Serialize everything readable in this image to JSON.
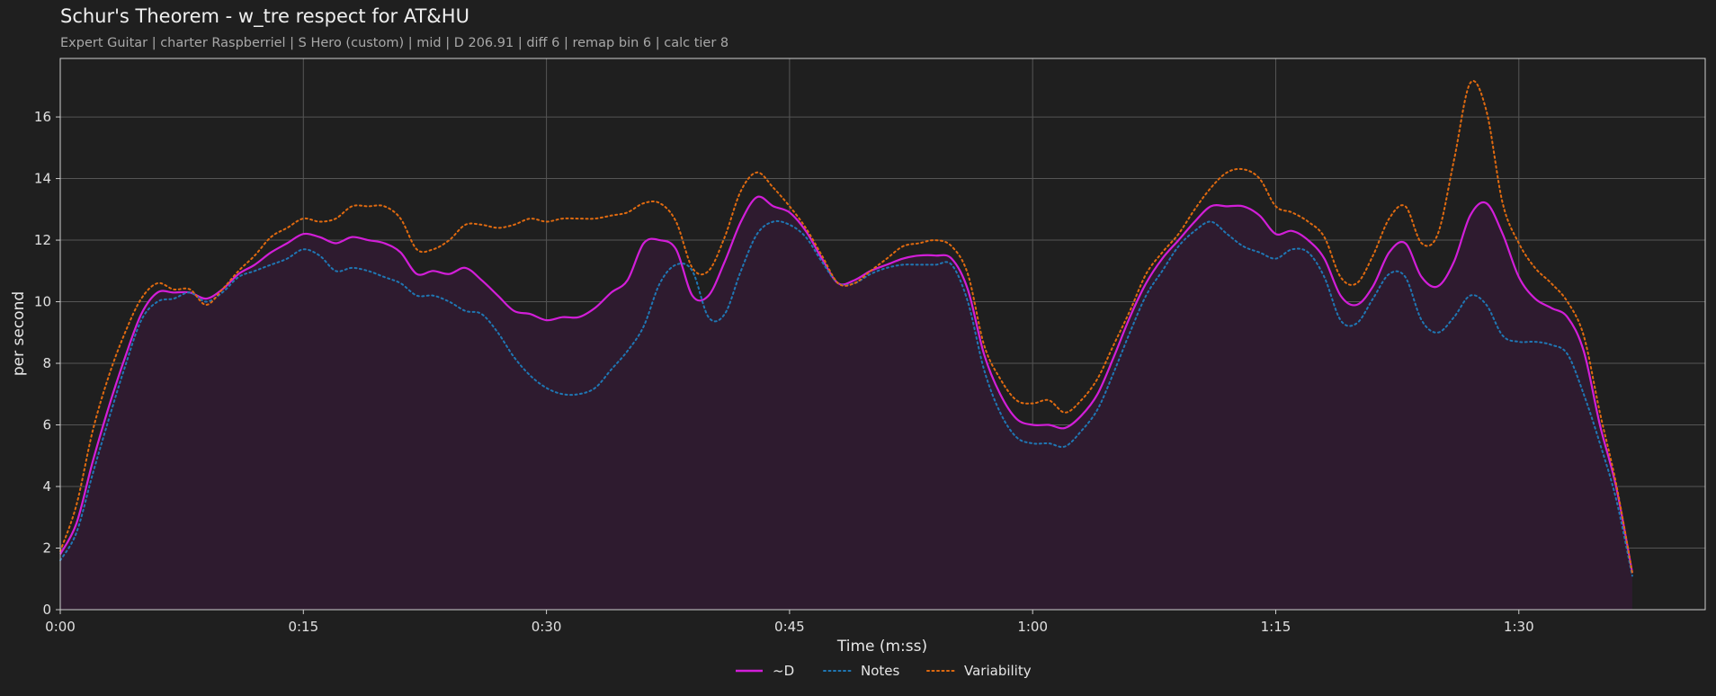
{
  "title": "Schur's Theorem - w_tre respect for AT&HU",
  "subtitle": "Expert Guitar  |  charter Raspberriel  |  S Hero (custom)  |  mid  |  D 206.91  |  diff 6  |  remap bin 6  |  calc tier 8",
  "colors": {
    "background": "#1f1f1f",
    "grid": "#555555",
    "d": "#d21ed8",
    "notes": "#1f77b4",
    "variability": "#e06a10",
    "fill": "#2e1b2f"
  },
  "chart_data": {
    "type": "line",
    "xlabel": "Time (m:ss)",
    "ylabel": "per second",
    "xlim": [
      0,
      101.5
    ],
    "ylim": [
      0,
      17.9
    ],
    "grid": true,
    "legend_position": "bottom-center",
    "x_ticks": [
      {
        "value": 0,
        "label": "0:00"
      },
      {
        "value": 15,
        "label": "0:15"
      },
      {
        "value": 30,
        "label": "0:30"
      },
      {
        "value": 45,
        "label": "0:45"
      },
      {
        "value": 60,
        "label": "1:00"
      },
      {
        "value": 75,
        "label": "1:15"
      },
      {
        "value": 90,
        "label": "1:30"
      }
    ],
    "y_ticks": [
      0,
      2,
      4,
      6,
      8,
      10,
      12,
      14,
      16
    ],
    "series": [
      {
        "name": "~D",
        "style": "solid",
        "filled": true,
        "points": [
          [
            0,
            1.8
          ],
          [
            1,
            2.8
          ],
          [
            2,
            4.8
          ],
          [
            3,
            6.6
          ],
          [
            4,
            8.2
          ],
          [
            5,
            9.6
          ],
          [
            6,
            10.3
          ],
          [
            7,
            10.3
          ],
          [
            8,
            10.3
          ],
          [
            9,
            10.1
          ],
          [
            10,
            10.4
          ],
          [
            11,
            10.9
          ],
          [
            12,
            11.2
          ],
          [
            13,
            11.6
          ],
          [
            14,
            11.9
          ],
          [
            15,
            12.2
          ],
          [
            16,
            12.1
          ],
          [
            17,
            11.9
          ],
          [
            18,
            12.1
          ],
          [
            19,
            12.0
          ],
          [
            20,
            11.9
          ],
          [
            21,
            11.6
          ],
          [
            22,
            10.9
          ],
          [
            23,
            11.0
          ],
          [
            24,
            10.9
          ],
          [
            25,
            11.1
          ],
          [
            26,
            10.7
          ],
          [
            27,
            10.2
          ],
          [
            28,
            9.7
          ],
          [
            29,
            9.6
          ],
          [
            30,
            9.4
          ],
          [
            31,
            9.5
          ],
          [
            32,
            9.5
          ],
          [
            33,
            9.8
          ],
          [
            34,
            10.3
          ],
          [
            35,
            10.7
          ],
          [
            36,
            11.9
          ],
          [
            37,
            12.0
          ],
          [
            38,
            11.7
          ],
          [
            39,
            10.2
          ],
          [
            40,
            10.2
          ],
          [
            41,
            11.3
          ],
          [
            42,
            12.6
          ],
          [
            43,
            13.4
          ],
          [
            44,
            13.1
          ],
          [
            45,
            12.9
          ],
          [
            46,
            12.3
          ],
          [
            47,
            11.4
          ],
          [
            48,
            10.6
          ],
          [
            49,
            10.7
          ],
          [
            50,
            11.0
          ],
          [
            51,
            11.2
          ],
          [
            52,
            11.4
          ],
          [
            53,
            11.5
          ],
          [
            54,
            11.5
          ],
          [
            55,
            11.4
          ],
          [
            56,
            10.4
          ],
          [
            57,
            8.3
          ],
          [
            58,
            7.0
          ],
          [
            59,
            6.2
          ],
          [
            60,
            6.0
          ],
          [
            61,
            6.0
          ],
          [
            62,
            5.9
          ],
          [
            63,
            6.3
          ],
          [
            64,
            7.0
          ],
          [
            65,
            8.2
          ],
          [
            66,
            9.5
          ],
          [
            67,
            10.6
          ],
          [
            68,
            11.4
          ],
          [
            69,
            12.0
          ],
          [
            70,
            12.6
          ],
          [
            71,
            13.1
          ],
          [
            72,
            13.1
          ],
          [
            73,
            13.1
          ],
          [
            74,
            12.8
          ],
          [
            75,
            12.2
          ],
          [
            76,
            12.3
          ],
          [
            77,
            12.0
          ],
          [
            78,
            11.4
          ],
          [
            79,
            10.2
          ],
          [
            80,
            9.9
          ],
          [
            81,
            10.5
          ],
          [
            82,
            11.6
          ],
          [
            83,
            11.9
          ],
          [
            84,
            10.8
          ],
          [
            85,
            10.5
          ],
          [
            86,
            11.3
          ],
          [
            87,
            12.8
          ],
          [
            88,
            13.2
          ],
          [
            89,
            12.2
          ],
          [
            90,
            10.8
          ],
          [
            91,
            10.1
          ],
          [
            92,
            9.8
          ],
          [
            93,
            9.5
          ],
          [
            94,
            8.4
          ],
          [
            95,
            6.0
          ],
          [
            96,
            4.0
          ],
          [
            97,
            1.2
          ]
        ]
      },
      {
        "name": "Notes",
        "style": "dotted",
        "filled": false,
        "points": [
          [
            0,
            1.6
          ],
          [
            1,
            2.5
          ],
          [
            2,
            4.4
          ],
          [
            3,
            6.2
          ],
          [
            4,
            7.9
          ],
          [
            5,
            9.4
          ],
          [
            6,
            10.0
          ],
          [
            7,
            10.1
          ],
          [
            8,
            10.3
          ],
          [
            9,
            10.0
          ],
          [
            10,
            10.3
          ],
          [
            11,
            10.8
          ],
          [
            12,
            11.0
          ],
          [
            13,
            11.2
          ],
          [
            14,
            11.4
          ],
          [
            15,
            11.7
          ],
          [
            16,
            11.5
          ],
          [
            17,
            11.0
          ],
          [
            18,
            11.1
          ],
          [
            19,
            11.0
          ],
          [
            20,
            10.8
          ],
          [
            21,
            10.6
          ],
          [
            22,
            10.2
          ],
          [
            23,
            10.2
          ],
          [
            24,
            10.0
          ],
          [
            25,
            9.7
          ],
          [
            26,
            9.6
          ],
          [
            27,
            9.0
          ],
          [
            28,
            8.2
          ],
          [
            29,
            7.6
          ],
          [
            30,
            7.2
          ],
          [
            31,
            7.0
          ],
          [
            32,
            7.0
          ],
          [
            33,
            7.2
          ],
          [
            34,
            7.8
          ],
          [
            35,
            8.4
          ],
          [
            36,
            9.2
          ],
          [
            37,
            10.6
          ],
          [
            38,
            11.2
          ],
          [
            39,
            11.0
          ],
          [
            40,
            9.5
          ],
          [
            41,
            9.6
          ],
          [
            42,
            11.0
          ],
          [
            43,
            12.2
          ],
          [
            44,
            12.6
          ],
          [
            45,
            12.5
          ],
          [
            46,
            12.1
          ],
          [
            47,
            11.3
          ],
          [
            48,
            10.6
          ],
          [
            49,
            10.6
          ],
          [
            50,
            10.9
          ],
          [
            51,
            11.1
          ],
          [
            52,
            11.2
          ],
          [
            53,
            11.2
          ],
          [
            54,
            11.2
          ],
          [
            55,
            11.2
          ],
          [
            56,
            10.0
          ],
          [
            57,
            7.8
          ],
          [
            58,
            6.4
          ],
          [
            59,
            5.6
          ],
          [
            60,
            5.4
          ],
          [
            61,
            5.4
          ],
          [
            62,
            5.3
          ],
          [
            63,
            5.8
          ],
          [
            64,
            6.5
          ],
          [
            65,
            7.7
          ],
          [
            66,
            9.0
          ],
          [
            67,
            10.2
          ],
          [
            68,
            11.0
          ],
          [
            69,
            11.8
          ],
          [
            70,
            12.3
          ],
          [
            71,
            12.6
          ],
          [
            72,
            12.2
          ],
          [
            73,
            11.8
          ],
          [
            74,
            11.6
          ],
          [
            75,
            11.4
          ],
          [
            76,
            11.7
          ],
          [
            77,
            11.6
          ],
          [
            78,
            10.8
          ],
          [
            79,
            9.4
          ],
          [
            80,
            9.3
          ],
          [
            81,
            10.1
          ],
          [
            82,
            10.9
          ],
          [
            83,
            10.8
          ],
          [
            84,
            9.4
          ],
          [
            85,
            9.0
          ],
          [
            86,
            9.5
          ],
          [
            87,
            10.2
          ],
          [
            88,
            9.9
          ],
          [
            89,
            8.9
          ],
          [
            90,
            8.7
          ],
          [
            91,
            8.7
          ],
          [
            92,
            8.6
          ],
          [
            93,
            8.3
          ],
          [
            94,
            7.0
          ],
          [
            95,
            5.4
          ],
          [
            96,
            3.6
          ],
          [
            97,
            1.1
          ]
        ]
      },
      {
        "name": "Variability",
        "style": "dotted",
        "filled": false,
        "points": [
          [
            0,
            1.9
          ],
          [
            1,
            3.4
          ],
          [
            2,
            5.8
          ],
          [
            3,
            7.6
          ],
          [
            4,
            9.0
          ],
          [
            5,
            10.1
          ],
          [
            6,
            10.6
          ],
          [
            7,
            10.4
          ],
          [
            8,
            10.4
          ],
          [
            9,
            9.9
          ],
          [
            10,
            10.4
          ],
          [
            11,
            11.0
          ],
          [
            12,
            11.5
          ],
          [
            13,
            12.1
          ],
          [
            14,
            12.4
          ],
          [
            15,
            12.7
          ],
          [
            16,
            12.6
          ],
          [
            17,
            12.7
          ],
          [
            18,
            13.1
          ],
          [
            19,
            13.1
          ],
          [
            20,
            13.1
          ],
          [
            21,
            12.7
          ],
          [
            22,
            11.7
          ],
          [
            23,
            11.7
          ],
          [
            24,
            12.0
          ],
          [
            25,
            12.5
          ],
          [
            26,
            12.5
          ],
          [
            27,
            12.4
          ],
          [
            28,
            12.5
          ],
          [
            29,
            12.7
          ],
          [
            30,
            12.6
          ],
          [
            31,
            12.7
          ],
          [
            32,
            12.7
          ],
          [
            33,
            12.7
          ],
          [
            34,
            12.8
          ],
          [
            35,
            12.9
          ],
          [
            36,
            13.2
          ],
          [
            37,
            13.2
          ],
          [
            38,
            12.6
          ],
          [
            39,
            11.1
          ],
          [
            40,
            11.0
          ],
          [
            41,
            12.1
          ],
          [
            42,
            13.6
          ],
          [
            43,
            14.2
          ],
          [
            44,
            13.7
          ],
          [
            45,
            13.1
          ],
          [
            46,
            12.4
          ],
          [
            47,
            11.5
          ],
          [
            48,
            10.6
          ],
          [
            49,
            10.6
          ],
          [
            50,
            11.0
          ],
          [
            51,
            11.4
          ],
          [
            52,
            11.8
          ],
          [
            53,
            11.9
          ],
          [
            54,
            12.0
          ],
          [
            55,
            11.8
          ],
          [
            56,
            10.9
          ],
          [
            57,
            8.6
          ],
          [
            58,
            7.5
          ],
          [
            59,
            6.8
          ],
          [
            60,
            6.7
          ],
          [
            61,
            6.8
          ],
          [
            62,
            6.4
          ],
          [
            63,
            6.8
          ],
          [
            64,
            7.5
          ],
          [
            65,
            8.6
          ],
          [
            66,
            9.7
          ],
          [
            67,
            10.9
          ],
          [
            68,
            11.6
          ],
          [
            69,
            12.2
          ],
          [
            70,
            13.0
          ],
          [
            71,
            13.7
          ],
          [
            72,
            14.2
          ],
          [
            73,
            14.3
          ],
          [
            74,
            14.0
          ],
          [
            75,
            13.1
          ],
          [
            76,
            12.9
          ],
          [
            77,
            12.6
          ],
          [
            78,
            12.1
          ],
          [
            79,
            10.8
          ],
          [
            80,
            10.6
          ],
          [
            81,
            11.5
          ],
          [
            82,
            12.7
          ],
          [
            83,
            13.1
          ],
          [
            84,
            11.9
          ],
          [
            85,
            12.2
          ],
          [
            86,
            14.6
          ],
          [
            87,
            17.1
          ],
          [
            88,
            16.2
          ],
          [
            89,
            13.2
          ],
          [
            90,
            11.9
          ],
          [
            91,
            11.1
          ],
          [
            92,
            10.6
          ],
          [
            93,
            10.0
          ],
          [
            94,
            8.9
          ],
          [
            95,
            6.4
          ],
          [
            96,
            4.1
          ],
          [
            97,
            1.2
          ]
        ]
      }
    ]
  }
}
